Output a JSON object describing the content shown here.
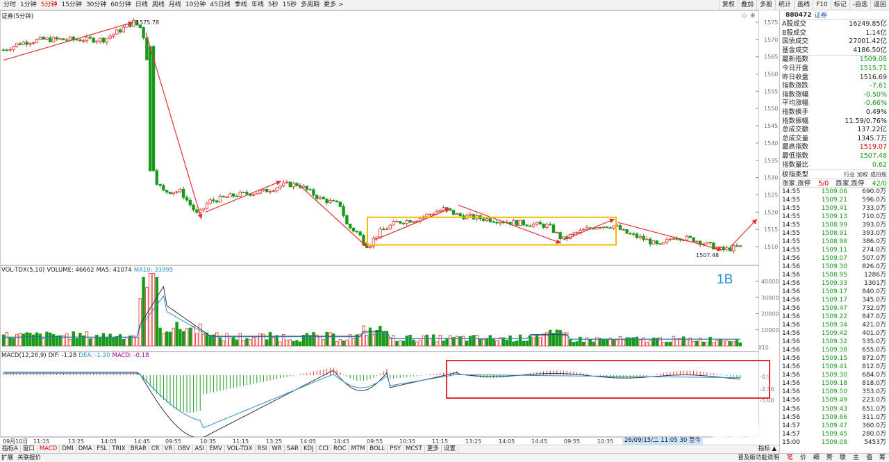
{
  "toolbar": {
    "periods": [
      "分时",
      "1分钟",
      "5分钟",
      "15分钟",
      "30分钟",
      "60分钟",
      "日线",
      "周线",
      "月线",
      "10分钟",
      "45日线",
      "季线",
      "年线",
      "5秒",
      "15秒",
      "多周期",
      "更多 >"
    ],
    "active_period": "5分钟",
    "right_tools": [
      "复权",
      "叠加",
      "多股",
      "统计",
      "画线",
      "F10",
      "标记",
      "-自选",
      "返回"
    ]
  },
  "main_chart": {
    "title": "证券(5分钟)",
    "price_axis": [
      "1575",
      "1570",
      "1565",
      "1560",
      "1555",
      "1550",
      "1545",
      "1540",
      "1535",
      "1530",
      "1525",
      "1520",
      "1515",
      "1510"
    ],
    "high_label": "1575.78",
    "low_label": "1507.48"
  },
  "volume_panel": {
    "legend": [
      {
        "text": "VOL-TDX(5,10)",
        "color": "#222222"
      },
      {
        "text": "VOLUME: 46662",
        "color": "#222222"
      },
      {
        "text": "MA5: 41074",
        "color": "#222222"
      },
      {
        "text": "MA10: 33995",
        "color": "#2a8fd8"
      }
    ],
    "axis": [
      "40000",
      "30000",
      "20000",
      "10000"
    ],
    "unit": "X10",
    "annotation": "1B"
  },
  "macd_panel": {
    "legend": [
      {
        "text": "MACD(12,26,9)",
        "color": "#222222"
      },
      {
        "text": "DIF: -1.28",
        "color": "#222222"
      },
      {
        "text": "DEA: -1.20",
        "color": "#2a8fd8"
      },
      {
        "text": "MACD: -0.18",
        "color": "#a000a0"
      }
    ],
    "axis": [
      "-0.9",
      "-2.50",
      "-5.00"
    ]
  },
  "date_ruler": {
    "labels": [
      "09月10日",
      "11:15",
      "13:25",
      "14:05",
      "14:45",
      "09:55",
      "10:35",
      "11:15",
      "13:25",
      "14:05",
      "14:45",
      "09:55",
      "10:35",
      "11:15",
      "13:25",
      "14:05",
      "14:45",
      "09:55",
      "10:35"
    ],
    "cursor": "26/09/15/二 11:05 30 至今"
  },
  "indicator_tabs": {
    "items": [
      "指标A",
      "窗口",
      "MACD",
      "DMI",
      "DMA",
      "FSL",
      "TRIX",
      "BRAR",
      "CR",
      "VR",
      "OBV",
      "ASI",
      "EMV",
      "VOL-TDX",
      "RSI",
      "WR",
      "SAR",
      "KDJ",
      "CCI",
      "ROC",
      "MTM",
      "BOLL",
      "PSY",
      "MCST",
      "更多",
      "设置"
    ],
    "active": "MACD",
    "indicator_button": "指标 ▲"
  },
  "right_panel": {
    "code": "880472",
    "name": "证券",
    "stats": [
      {
        "k": "A股成交",
        "v": "16249.85亿",
        "c": "#222222"
      },
      {
        "k": "B股成交",
        "v": "1.14亿",
        "c": "#222222"
      },
      {
        "k": "国债成交",
        "v": "27001.42亿",
        "c": "#222222"
      },
      {
        "k": "基金成交",
        "v": "4186.50亿",
        "c": "#222222"
      }
    ],
    "quotes": [
      {
        "k": "最新指数",
        "v": "1509.08",
        "c": "#1a9a1a"
      },
      {
        "k": "今日开盘",
        "v": "1515.71",
        "c": "#1a9a1a"
      },
      {
        "k": "昨日收盘",
        "v": "1516.69",
        "c": "#222222"
      },
      {
        "k": "指数涨跌",
        "v": "-7.61",
        "c": "#1a9a1a"
      },
      {
        "k": "指数涨幅",
        "v": "-0.50%",
        "c": "#1a9a1a"
      },
      {
        "k": "平均涨幅",
        "v": "-0.66%",
        "c": "#1a9a1a"
      },
      {
        "k": "指数换手",
        "v": "0.49%",
        "c": "#222222"
      },
      {
        "k": "指数振幅",
        "v": "11.59/0.76%",
        "c": "#222222"
      },
      {
        "k": "总成交额",
        "v": "137.22亿",
        "c": "#222222"
      },
      {
        "k": "总成交量",
        "v": "1345.7万",
        "c": "#222222"
      },
      {
        "k": "最高指数",
        "v": "1519.07",
        "c": "#e00000"
      },
      {
        "k": "最低指数",
        "v": "1507.48",
        "c": "#1a9a1a"
      },
      {
        "k": "指数量比",
        "v": "0.62",
        "c": "#1a9a1a"
      }
    ],
    "board_type_label": "板指类型",
    "board_links": [
      "行业",
      "加权",
      "成份股"
    ],
    "limit_row": {
      "up_label": "涨家.涨停",
      "up_val": "5/0",
      "down_label": "跌家.跌停",
      "down_val": "42/0"
    },
    "ticks": [
      [
        "14:55",
        "1509.06",
        "690.0万"
      ],
      [
        "14:55",
        "1509.21",
        "596.0万"
      ],
      [
        "14:55",
        "1509.41",
        "733.0万"
      ],
      [
        "14:55",
        "1509.13",
        "710.0万"
      ],
      [
        "14:55",
        "1508.99",
        "393.0万"
      ],
      [
        "14:55",
        "1508.91",
        "393.0万"
      ],
      [
        "14:55",
        "1508.98",
        "386.0万"
      ],
      [
        "14:55",
        "1509.11",
        "274.0万"
      ],
      [
        "14:56",
        "1509.07",
        "507.0万"
      ],
      [
        "14:56",
        "1509.30",
        "826.0万"
      ],
      [
        "14:56",
        "1508.95",
        "1286万"
      ],
      [
        "14:56",
        "1509.33",
        "1301万"
      ],
      [
        "14:56",
        "1509.17",
        "840.0万"
      ],
      [
        "14:56",
        "1509.17",
        "345.0万"
      ],
      [
        "14:56",
        "1509.47",
        "732.0万"
      ],
      [
        "14:56",
        "1509.22",
        "847.0万"
      ],
      [
        "14:56",
        "1509.34",
        "421.0万"
      ],
      [
        "14:56",
        "1509.42",
        "401.0万"
      ],
      [
        "14:56",
        "1509.32",
        "535.0万"
      ],
      [
        "14:56",
        "1509.38",
        "655.0万"
      ],
      [
        "14:56",
        "1509.15",
        "872.0万"
      ],
      [
        "14:56",
        "1509.41",
        "812.0万"
      ],
      [
        "14:56",
        "1509.30",
        "684.0万"
      ],
      [
        "14:56",
        "1509.18",
        "818.0万"
      ],
      [
        "14:56",
        "1509.50",
        "353.0万"
      ],
      [
        "14:56",
        "1509.49",
        "223.0万"
      ],
      [
        "14:56",
        "1509.43",
        "651.0万"
      ],
      [
        "14:56",
        "1509.66",
        "311.0万"
      ],
      [
        "14:57",
        "1509.47",
        "360.0万"
      ],
      [
        "14:57",
        "1509.45",
        "280.0万"
      ],
      [
        "15:00",
        "1509.08",
        "5453万"
      ]
    ]
  },
  "statusbar": {
    "left": [
      "扩展",
      "关联报价"
    ],
    "report_link": "普及版功能说明",
    "buttons": [
      "笔",
      "价",
      "细",
      "势",
      "联",
      "主",
      "值",
      "筹"
    ],
    "active_button": "笔"
  },
  "colors": {
    "up": "#e03030",
    "down": "#1a9a1a",
    "ma10": "#2a8fd8",
    "highlight_yellow": "#f5b800",
    "highlight_red": "#e03030"
  }
}
